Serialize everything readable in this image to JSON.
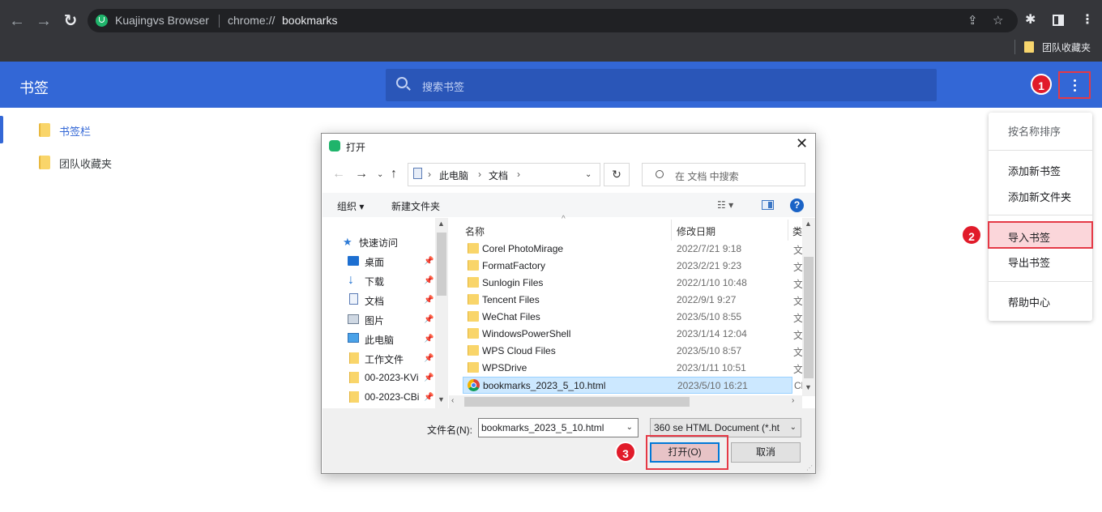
{
  "browser": {
    "site_name": "Kuajingvs Browser",
    "url_prefix": "chrome://",
    "url_host": "bookmarks",
    "bookmark_bar_item": "团队收藏夹"
  },
  "header": {
    "title": "书签",
    "search_placeholder": "搜索书签"
  },
  "sidebar": {
    "items": [
      {
        "label": "书签栏",
        "active": true
      },
      {
        "label": "团队收藏夹",
        "active": false
      }
    ]
  },
  "menu": {
    "sort": "按名称排序",
    "add_bookmark": "添加新书签",
    "add_folder": "添加新文件夹",
    "import": "导入书签",
    "export": "导出书签",
    "help": "帮助中心"
  },
  "steps": {
    "one": "1",
    "two": "2",
    "three": "3"
  },
  "dialog": {
    "title": "打开",
    "breadcrumb": [
      "此电脑",
      "文档"
    ],
    "search_placeholder": "在 文档 中搜索",
    "organize": "组织 ▾",
    "new_folder": "新建文件夹",
    "tree": {
      "quick_access": "快速访问",
      "items": [
        "桌面",
        "下载",
        "文档",
        "图片",
        "此电脑",
        "工作文件",
        "00-2023-KVi",
        "00-2023-CBi"
      ]
    },
    "columns": {
      "name": "名称",
      "date": "修改日期",
      "type": "类"
    },
    "files": [
      {
        "name": "Corel PhotoMirage",
        "date": "2022/7/21 9:18",
        "type": "文"
      },
      {
        "name": "FormatFactory",
        "date": "2023/2/21 9:23",
        "type": "文"
      },
      {
        "name": "Sunlogin Files",
        "date": "2022/1/10 10:48",
        "type": "文"
      },
      {
        "name": "Tencent Files",
        "date": "2022/9/1 9:27",
        "type": "文"
      },
      {
        "name": "WeChat Files",
        "date": "2023/5/10 8:55",
        "type": "文"
      },
      {
        "name": "WindowsPowerShell",
        "date": "2023/1/14 12:04",
        "type": "文"
      },
      {
        "name": "WPS Cloud Files",
        "date": "2023/5/10 8:57",
        "type": "文"
      },
      {
        "name": "WPSDrive",
        "date": "2023/1/11 10:51",
        "type": "文"
      },
      {
        "name": "bookmarks_2023_5_10.html",
        "date": "2023/5/10 16:21",
        "type": "Cl"
      }
    ],
    "filename_label": "文件名(N):",
    "filename_value": "bookmarks_2023_5_10.html",
    "filetype_value": "360 se HTML Document (*.ht",
    "open_button": "打开(O)",
    "cancel_button": "取消"
  }
}
